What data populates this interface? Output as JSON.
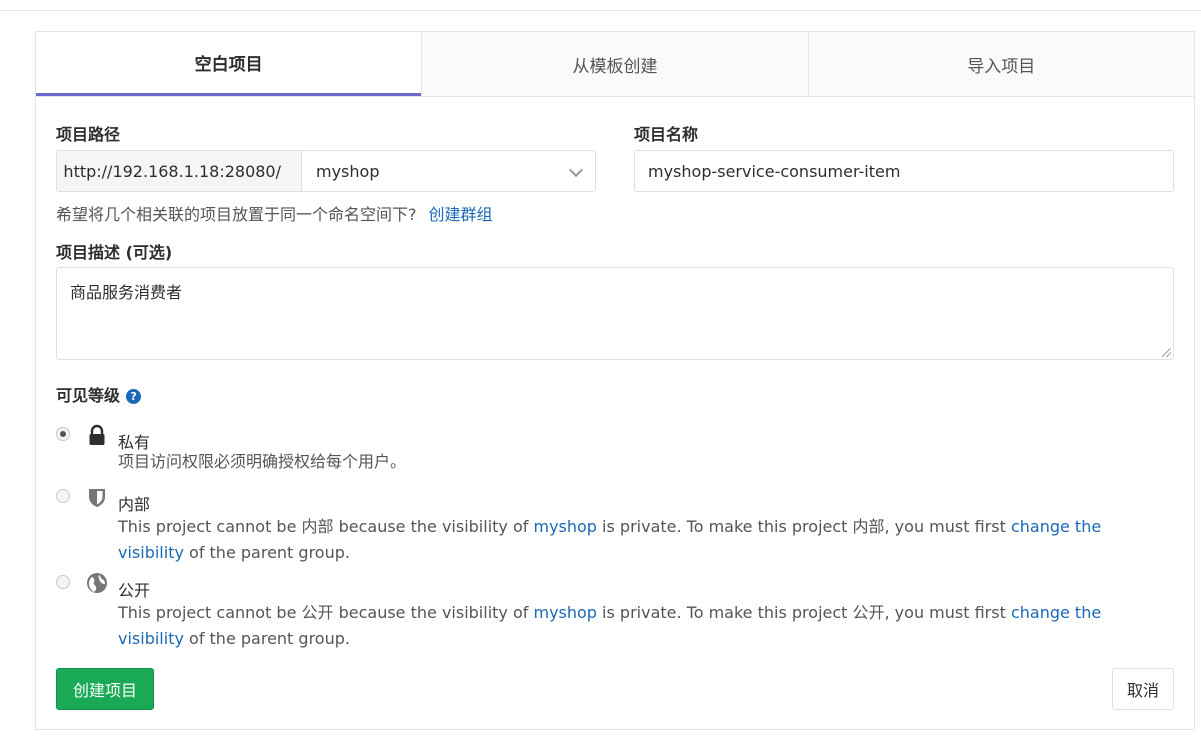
{
  "tabs": [
    {
      "label": "空白项目",
      "active": true
    },
    {
      "label": "从模板创建",
      "active": false
    },
    {
      "label": "导入项目",
      "active": false
    }
  ],
  "form": {
    "path_label": "项目路径",
    "path_prefix": "http://192.168.1.18:28080/",
    "namespace_value": "myshop",
    "name_label": "项目名称",
    "name_value": "myshop-service-consumer-item",
    "hint_text": "希望将几个相关联的项目放置于同一个命名空间下?",
    "hint_link": "创建群组",
    "desc_label": "项目描述 (可选)",
    "desc_value": "商品服务消费者"
  },
  "visibility": {
    "label": "可见等级",
    "help_icon": "?",
    "options": [
      {
        "title": "私有",
        "icon": "lock-icon",
        "checked": true,
        "desc": "项目访问权限必须明确授权给每个用户。"
      },
      {
        "title": "内部",
        "icon": "shield-icon",
        "checked": false,
        "desc_pre": "This project cannot be 内部 because the visibility of ",
        "desc_link1": "myshop",
        "desc_mid": " is private. To make this project 内部, you must first ",
        "desc_link2": "change the visibility",
        "desc_post": " of the parent group."
      },
      {
        "title": "公开",
        "icon": "globe-icon",
        "checked": false,
        "desc_pre": "This project cannot be 公开 because the visibility of ",
        "desc_link1": "myshop",
        "desc_mid": " is private. To make this project 公开, you must first ",
        "desc_link2": "change the visibility",
        "desc_post": " of the parent group."
      }
    ]
  },
  "actions": {
    "create_label": "创建项目",
    "cancel_label": "取消"
  },
  "colors": {
    "accent_tab": "#6b6bcf",
    "link": "#1b69b6",
    "create_button": "#1aaa55"
  }
}
